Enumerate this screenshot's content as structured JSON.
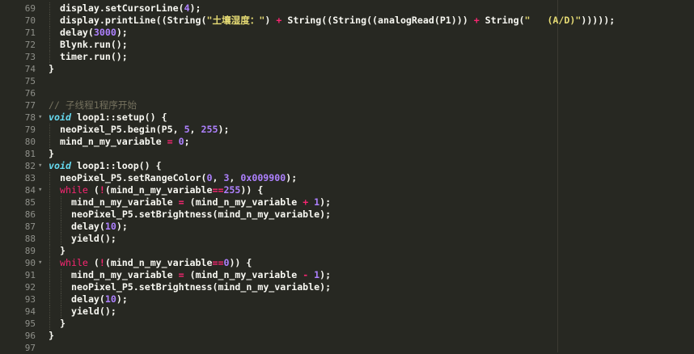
{
  "editor": {
    "colors": {
      "background": "#272822",
      "gutter_text": "#8f908a",
      "keyword": "#66d9ef",
      "flow": "#f92672",
      "number": "#ae81ff",
      "string": "#e6db74",
      "comment": "#75715e",
      "text": "#f8f8f2"
    },
    "lines": [
      {
        "n": "69",
        "fold": "",
        "indent": 1,
        "tokens": [
          {
            "c": "txt",
            "t": "display.setCursorLine("
          },
          {
            "c": "num",
            "t": "4"
          },
          {
            "c": "txt",
            "t": ");"
          }
        ]
      },
      {
        "n": "70",
        "fold": "",
        "indent": 1,
        "tokens": [
          {
            "c": "txt",
            "t": "display.printLine((String("
          },
          {
            "c": "str",
            "t": "\"土壤湿度：\""
          },
          {
            "c": "txt",
            "t": ") "
          },
          {
            "c": "op",
            "t": "+"
          },
          {
            "c": "txt",
            "t": " String((String((analogRead(P1))) "
          },
          {
            "c": "op",
            "t": "+"
          },
          {
            "c": "txt",
            "t": " String("
          },
          {
            "c": "str",
            "t": "\"   (A/D)\""
          },
          {
            "c": "txt",
            "t": ")))));"
          }
        ]
      },
      {
        "n": "71",
        "fold": "",
        "indent": 1,
        "tokens": [
          {
            "c": "txt",
            "t": "delay("
          },
          {
            "c": "num",
            "t": "3000"
          },
          {
            "c": "txt",
            "t": ");"
          }
        ]
      },
      {
        "n": "72",
        "fold": "",
        "indent": 1,
        "tokens": [
          {
            "c": "txt",
            "t": "Blynk.run();"
          }
        ]
      },
      {
        "n": "73",
        "fold": "",
        "indent": 1,
        "tokens": [
          {
            "c": "txt",
            "t": "timer.run();"
          }
        ]
      },
      {
        "n": "74",
        "fold": "",
        "indent": 0,
        "tokens": [
          {
            "c": "txt",
            "t": "}"
          }
        ]
      },
      {
        "n": "75",
        "fold": "",
        "indent": 0,
        "tokens": []
      },
      {
        "n": "76",
        "fold": "",
        "indent": 0,
        "tokens": []
      },
      {
        "n": "77",
        "fold": "",
        "indent": 0,
        "tokens": [
          {
            "c": "com",
            "t": "// 子线程1程序开始"
          }
        ]
      },
      {
        "n": "78",
        "fold": "▾",
        "indent": 0,
        "tokens": [
          {
            "c": "kw",
            "t": "void"
          },
          {
            "c": "txt",
            "t": " loop1::setup() {"
          }
        ]
      },
      {
        "n": "79",
        "fold": "",
        "indent": 1,
        "tokens": [
          {
            "c": "txt",
            "t": "neoPixel_P5.begin(P5, "
          },
          {
            "c": "num",
            "t": "5"
          },
          {
            "c": "txt",
            "t": ", "
          },
          {
            "c": "num",
            "t": "255"
          },
          {
            "c": "txt",
            "t": ");"
          }
        ]
      },
      {
        "n": "80",
        "fold": "",
        "indent": 1,
        "tokens": [
          {
            "c": "txt",
            "t": "mind_n_my_variable "
          },
          {
            "c": "op",
            "t": "="
          },
          {
            "c": "txt",
            "t": " "
          },
          {
            "c": "num",
            "t": "0"
          },
          {
            "c": "txt",
            "t": ";"
          }
        ]
      },
      {
        "n": "81",
        "fold": "",
        "indent": 0,
        "tokens": [
          {
            "c": "txt",
            "t": "}"
          }
        ]
      },
      {
        "n": "82",
        "fold": "▾",
        "indent": 0,
        "tokens": [
          {
            "c": "kw",
            "t": "void"
          },
          {
            "c": "txt",
            "t": " loop1::loop() {"
          }
        ]
      },
      {
        "n": "83",
        "fold": "",
        "indent": 1,
        "tokens": [
          {
            "c": "txt",
            "t": "neoPixel_P5.setRangeColor("
          },
          {
            "c": "num",
            "t": "0"
          },
          {
            "c": "txt",
            "t": ", "
          },
          {
            "c": "num",
            "t": "3"
          },
          {
            "c": "txt",
            "t": ", "
          },
          {
            "c": "num",
            "t": "0x009900"
          },
          {
            "c": "txt",
            "t": ");"
          }
        ]
      },
      {
        "n": "84",
        "fold": "▾",
        "indent": 1,
        "tokens": [
          {
            "c": "fl",
            "t": "while"
          },
          {
            "c": "txt",
            "t": " ("
          },
          {
            "c": "op",
            "t": "!"
          },
          {
            "c": "txt",
            "t": "(mind_n_my_variable"
          },
          {
            "c": "op",
            "t": "=="
          },
          {
            "c": "num",
            "t": "255"
          },
          {
            "c": "txt",
            "t": ")) {"
          }
        ]
      },
      {
        "n": "85",
        "fold": "",
        "indent": 2,
        "tokens": [
          {
            "c": "txt",
            "t": "mind_n_my_variable "
          },
          {
            "c": "op",
            "t": "="
          },
          {
            "c": "txt",
            "t": " (mind_n_my_variable "
          },
          {
            "c": "op",
            "t": "+"
          },
          {
            "c": "txt",
            "t": " "
          },
          {
            "c": "num",
            "t": "1"
          },
          {
            "c": "txt",
            "t": ");"
          }
        ]
      },
      {
        "n": "86",
        "fold": "",
        "indent": 2,
        "tokens": [
          {
            "c": "txt",
            "t": "neoPixel_P5.setBrightness(mind_n_my_variable);"
          }
        ]
      },
      {
        "n": "87",
        "fold": "",
        "indent": 2,
        "tokens": [
          {
            "c": "txt",
            "t": "delay("
          },
          {
            "c": "num",
            "t": "10"
          },
          {
            "c": "txt",
            "t": ");"
          }
        ]
      },
      {
        "n": "88",
        "fold": "",
        "indent": 2,
        "tokens": [
          {
            "c": "txt",
            "t": "yield();"
          }
        ]
      },
      {
        "n": "89",
        "fold": "",
        "indent": 1,
        "tokens": [
          {
            "c": "txt",
            "t": "}"
          }
        ]
      },
      {
        "n": "90",
        "fold": "▾",
        "indent": 1,
        "tokens": [
          {
            "c": "fl",
            "t": "while"
          },
          {
            "c": "txt",
            "t": " ("
          },
          {
            "c": "op",
            "t": "!"
          },
          {
            "c": "txt",
            "t": "(mind_n_my_variable"
          },
          {
            "c": "op",
            "t": "=="
          },
          {
            "c": "num",
            "t": "0"
          },
          {
            "c": "txt",
            "t": ")) {"
          }
        ]
      },
      {
        "n": "91",
        "fold": "",
        "indent": 2,
        "tokens": [
          {
            "c": "txt",
            "t": "mind_n_my_variable "
          },
          {
            "c": "op",
            "t": "="
          },
          {
            "c": "txt",
            "t": " (mind_n_my_variable "
          },
          {
            "c": "op",
            "t": "-"
          },
          {
            "c": "txt",
            "t": " "
          },
          {
            "c": "num",
            "t": "1"
          },
          {
            "c": "txt",
            "t": ");"
          }
        ]
      },
      {
        "n": "92",
        "fold": "",
        "indent": 2,
        "tokens": [
          {
            "c": "txt",
            "t": "neoPixel_P5.setBrightness(mind_n_my_variable);"
          }
        ]
      },
      {
        "n": "93",
        "fold": "",
        "indent": 2,
        "tokens": [
          {
            "c": "txt",
            "t": "delay("
          },
          {
            "c": "num",
            "t": "10"
          },
          {
            "c": "txt",
            "t": ");"
          }
        ]
      },
      {
        "n": "94",
        "fold": "",
        "indent": 2,
        "tokens": [
          {
            "c": "txt",
            "t": "yield();"
          }
        ]
      },
      {
        "n": "95",
        "fold": "",
        "indent": 1,
        "tokens": [
          {
            "c": "txt",
            "t": "}"
          }
        ]
      },
      {
        "n": "96",
        "fold": "",
        "indent": 0,
        "tokens": [
          {
            "c": "txt",
            "t": "}"
          }
        ]
      },
      {
        "n": "97",
        "fold": "",
        "indent": 0,
        "tokens": []
      }
    ]
  }
}
